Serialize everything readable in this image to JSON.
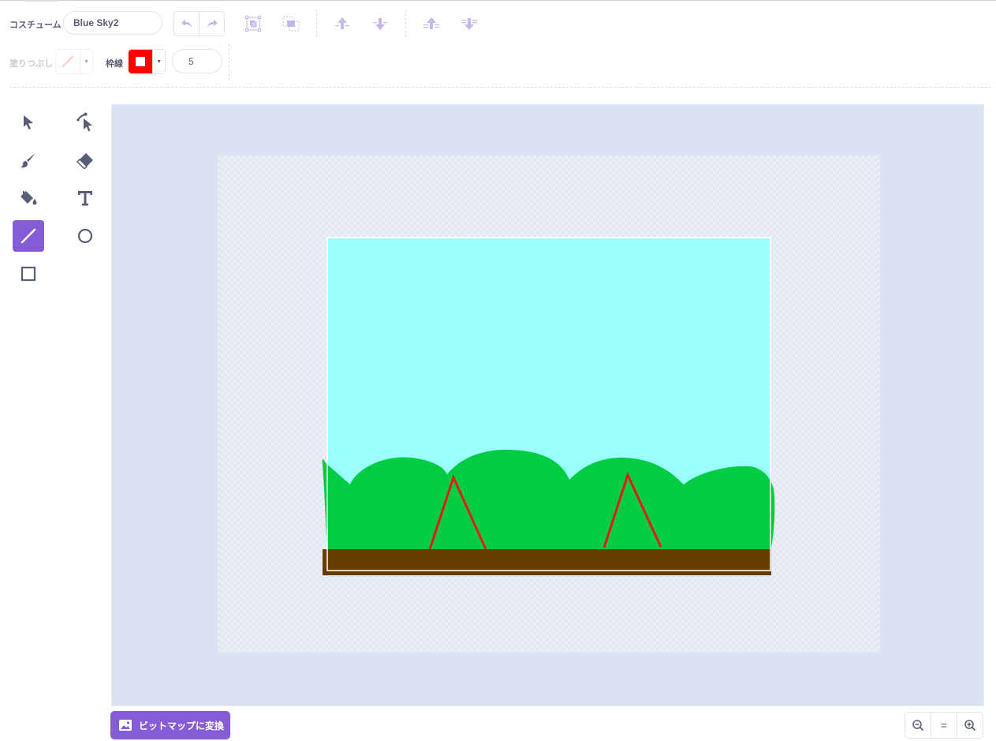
{
  "costume": {
    "label": "コスチューム",
    "name_value": "Blue Sky2"
  },
  "toolbar": {
    "undo_icon": "undo-icon",
    "redo_icon": "redo-icon",
    "group_icon": "group-icon",
    "ungroup_icon": "ungroup-icon",
    "forward_icon": "forward-icon",
    "backward_icon": "backward-icon",
    "front_icon": "front-icon",
    "back_icon": "back-icon"
  },
  "fill": {
    "label": "塗りつぶし",
    "state": "none"
  },
  "outline": {
    "label": "枠線",
    "color": "#ff0000",
    "width_value": "5"
  },
  "tools": [
    "select",
    "reshape",
    "brush",
    "eraser",
    "fill",
    "text",
    "line",
    "circle",
    "rectangle"
  ],
  "active_tool": "line",
  "colors": {
    "accent": "#855cd6",
    "sky": "#9bfffd",
    "grass": "#00cc44",
    "ground": "#663d00",
    "line": "#e31b1b",
    "canvas_bg": "#d9e3f2"
  },
  "footer": {
    "convert_label": "ビットマップに変換",
    "zoom_out_icon": "zoom-out-icon",
    "zoom_reset_label": "=",
    "zoom_in_icon": "zoom-in-icon"
  }
}
